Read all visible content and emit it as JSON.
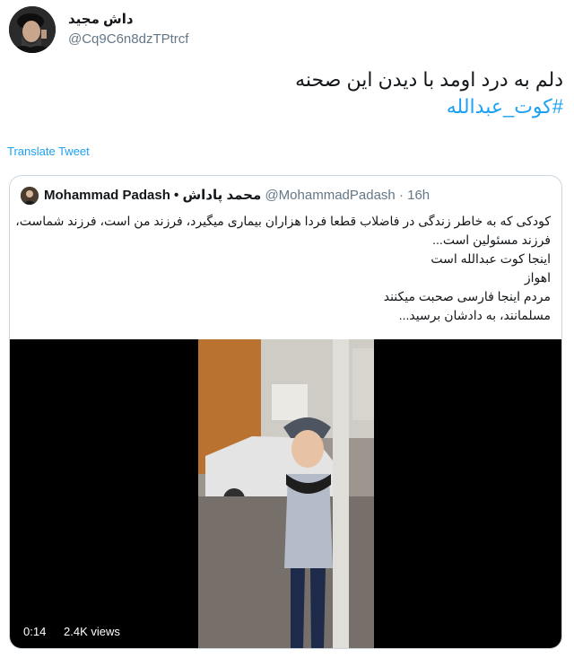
{
  "author": {
    "name": "داش مجید",
    "handle": "@Cq9C6n8dzTPtrcf"
  },
  "tweet": {
    "text": "دلم به درد اومد با دیدن این صحنه",
    "hashtag": "#کوت_عبدالله"
  },
  "translate_label": "Translate Tweet",
  "quoted": {
    "name_en": "Mohammad Padash",
    "bullet": "•",
    "name_fa": "محمد پاداش",
    "handle": "@MohammadPadash",
    "time": "· 16h",
    "lines": [
      "کودکی که به خاطر زندگی در فاضلاب قطعا فردا هزاران بیماری میگیرد، فرزند من است، فرزند شماست،",
      "فرزند مسئولین است...",
      "اینجا کوت عبدالله است",
      "اهواز",
      "مردم اینجا فارسی صحبت میکنند",
      "مسلمانند، به دادشان برسید..."
    ],
    "video": {
      "duration": "0:14",
      "views": "2.4K views"
    }
  },
  "colors": {
    "accent": "#1da1f2",
    "text": "#14171a",
    "muted": "#657786",
    "border": "#ccd6dd"
  }
}
